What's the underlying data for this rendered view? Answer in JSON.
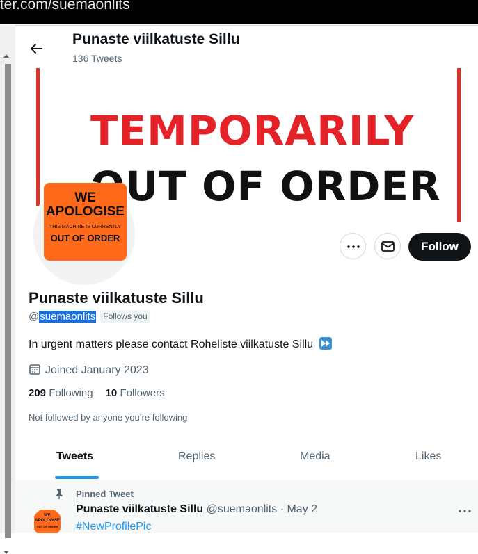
{
  "browser": {
    "url_fragment": "tter.com/suemaonlits"
  },
  "header": {
    "title": "Punaste viilkatuste Sillu",
    "tweet_count": "136 Tweets"
  },
  "banner": {
    "line1": "TEMPORARILY",
    "line2": "OUT OF ORDER"
  },
  "avatar": {
    "line1": "WE",
    "line2": "APOLOGISE",
    "line3": "THIS MACHINE IS CURRENTLY",
    "line4": "OUT OF ORDER"
  },
  "actions": {
    "follow_label": "Follow"
  },
  "profile": {
    "name": "Punaste viilkatuste Sillu",
    "handle_prefix": "@",
    "handle": "suemaonlits",
    "follows_you": "Follows you",
    "bio": "In urgent matters please contact Roheliste viilkatuste Sillu",
    "joined": "Joined January 2023",
    "following_count": "209",
    "following_label": "Following",
    "followers_count": "10",
    "followers_label": "Followers",
    "not_followed": "Not followed by anyone you’re following"
  },
  "tabs": [
    "Tweets",
    "Replies",
    "Media",
    "Likes"
  ],
  "active_tab": "Tweets",
  "pinned_tweet": {
    "label": "Pinned Tweet",
    "author": "Punaste viilkatuste Sillu",
    "meta": "@suemaonlits · May 2",
    "hashtag": "#NewProfilePic"
  },
  "colors": {
    "accent": "#1d9bf0",
    "banner_red": "#e42328",
    "sticker_orange": "#ff6a1a",
    "button_dark": "#0f1419"
  }
}
